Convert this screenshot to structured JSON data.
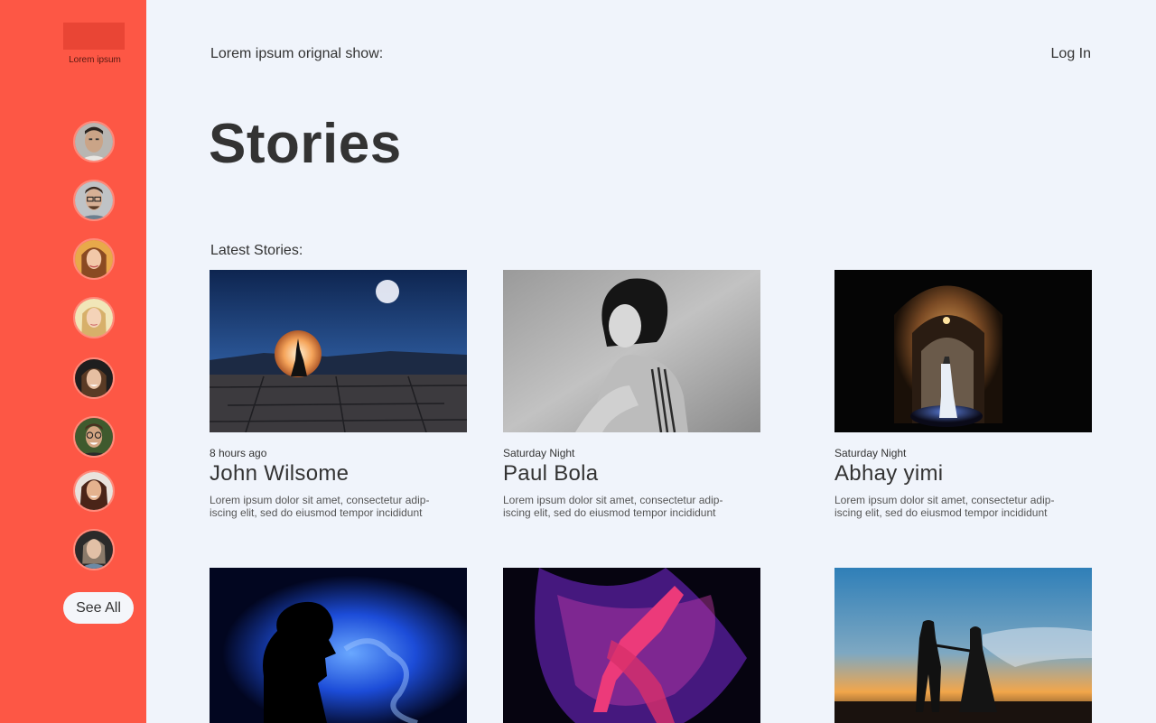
{
  "sidebar": {
    "logo_text": "Lorem ipsum",
    "see_all_label": "See All",
    "avatars": [
      "avatar-1",
      "avatar-2",
      "avatar-3",
      "avatar-4",
      "avatar-5",
      "avatar-6",
      "avatar-7",
      "avatar-8"
    ]
  },
  "header": {
    "show_label": "Lorem ipsum orignal show:",
    "login_label": "Log In"
  },
  "page": {
    "title": "Stories",
    "section_label": "Latest Stories:"
  },
  "stories": [
    {
      "time": "8 hours ago",
      "name": "John Wilsome",
      "desc": "Lorem ipsum dolor sit amet, consectetur adip-\niscing elit, sed do eiusmod tempor incididunt"
    },
    {
      "time": "Saturday Night",
      "name": "Paul Bola",
      "desc": "Lorem ipsum dolor sit amet, consectetur adip-\niscing elit, sed do eiusmod tempor incididunt"
    },
    {
      "time": "Saturday Night",
      "name": "Abhay yimi",
      "desc": "Lorem ipsum dolor sit amet, consectetur adip-\niscing elit, sed do eiusmod tempor incididunt"
    }
  ],
  "colors": {
    "sidebar": "#fd5745",
    "logo": "#e94535",
    "background": "#f0f4fb",
    "text": "#333333"
  }
}
